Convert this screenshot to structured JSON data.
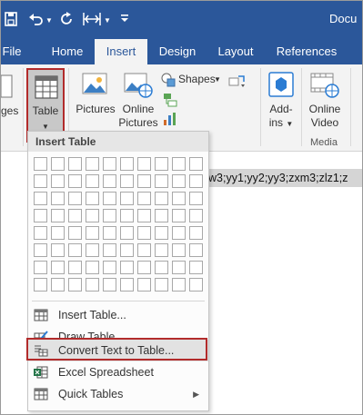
{
  "colors": {
    "accent": "#2b579a",
    "highlight_border": "#b22b2b",
    "ribbon_bg": "#f3f3f3"
  },
  "titlebar": {
    "doc_title": "Docu",
    "qat_icons": [
      "save-icon",
      "undo-icon",
      "redo-icon",
      "customize-qat-icon"
    ]
  },
  "tabs": [
    {
      "label": "File"
    },
    {
      "label": "Home"
    },
    {
      "label": "Insert",
      "active": true
    },
    {
      "label": "Design"
    },
    {
      "label": "Layout"
    },
    {
      "label": "References"
    }
  ],
  "ribbon": {
    "partial_left_label": "ges",
    "table_label": "Table",
    "pictures_label": "Pictures",
    "online_pictures_label_1": "Online",
    "online_pictures_label_2": "Pictures",
    "shapes_label": "Shapes",
    "addins_label_1": "Add-",
    "addins_label_2": "ins",
    "online_video_label_1": "Online",
    "online_video_label_2": "Video",
    "media_group_label": "Media"
  },
  "document": {
    "selected_text": "w3;yy1;yy2;yy3;zxm3;zlz1;z"
  },
  "insert_table_menu": {
    "header": "Insert Table",
    "grid_columns": 10,
    "grid_rows": 8,
    "items": [
      {
        "label": "Insert Table...",
        "icon": "table-icon"
      },
      {
        "label": "Draw Table",
        "icon": "draw-table-icon"
      },
      {
        "label": "Convert Text to Table...",
        "icon": "convert-text-icon",
        "highlighted": true
      },
      {
        "label": "Excel Spreadsheet",
        "icon": "excel-icon"
      },
      {
        "label": "Quick Tables",
        "icon": "quick-tables-icon",
        "submenu": true
      }
    ]
  }
}
